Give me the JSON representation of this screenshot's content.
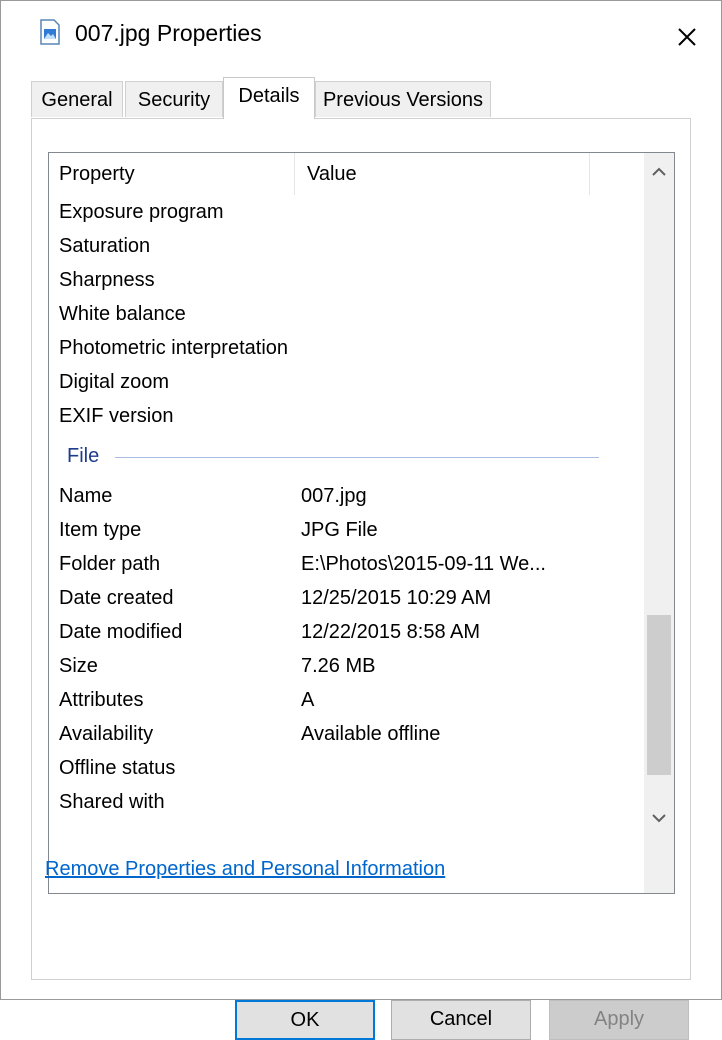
{
  "window": {
    "title": "007.jpg Properties",
    "icon": "image-file-icon"
  },
  "tabs": [
    {
      "label": "General",
      "active": false
    },
    {
      "label": "Security",
      "active": false
    },
    {
      "label": "Details",
      "active": true
    },
    {
      "label": "Previous Versions",
      "active": false
    }
  ],
  "details": {
    "columns": {
      "property": "Property",
      "value": "Value"
    },
    "image_rows": [
      {
        "property": "Exposure program",
        "value": ""
      },
      {
        "property": "Saturation",
        "value": ""
      },
      {
        "property": "Sharpness",
        "value": ""
      },
      {
        "property": "White balance",
        "value": ""
      },
      {
        "property": "Photometric interpretation",
        "value": ""
      },
      {
        "property": "Digital zoom",
        "value": ""
      },
      {
        "property": "EXIF version",
        "value": ""
      }
    ],
    "group_file": "File",
    "file_rows": [
      {
        "property": "Name",
        "value": "007.jpg"
      },
      {
        "property": "Item type",
        "value": "JPG File"
      },
      {
        "property": "Folder path",
        "value": "E:\\Photos\\2015-09-11 We..."
      },
      {
        "property": "Date created",
        "value": "12/25/2015 10:29 AM"
      },
      {
        "property": "Date modified",
        "value": "12/22/2015 8:58 AM"
      },
      {
        "property": "Size",
        "value": "7.26 MB"
      },
      {
        "property": "Attributes",
        "value": "A"
      },
      {
        "property": "Availability",
        "value": "Available offline"
      },
      {
        "property": "Offline status",
        "value": ""
      },
      {
        "property": "Shared with",
        "value": ""
      }
    ]
  },
  "remove_link": "Remove Properties and Personal Information",
  "buttons": {
    "ok": "OK",
    "cancel": "Cancel",
    "apply": "Apply"
  },
  "colors": {
    "accent": "#0078d7",
    "link": "#0066cc",
    "group": "#1e3c8c"
  }
}
